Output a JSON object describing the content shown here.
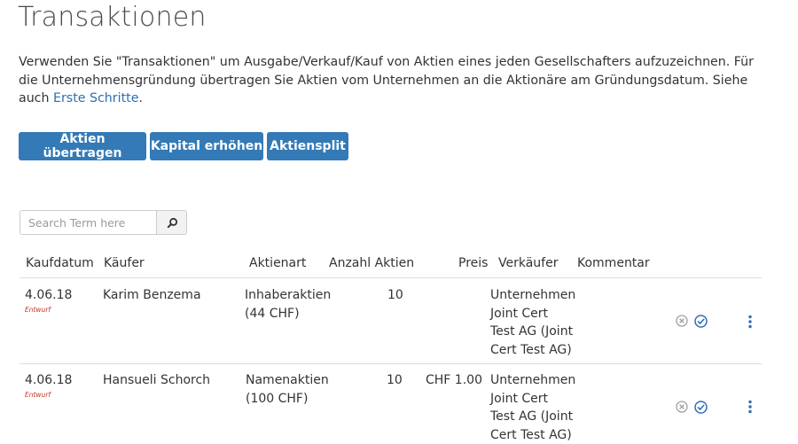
{
  "page": {
    "title": "Transaktionen",
    "intro_text": "Verwenden Sie \"Transaktionen\" um Ausgabe/Verkauf/Kauf von Aktien eines jeden Gesellschafters aufzuzeichnen. Für die Unternehmensgründung übertragen Sie Aktien vom Unternehmen an die Aktionäre am Gründungsdatum. Siehe auch ",
    "intro_link": "Erste Schritte",
    "intro_end": "."
  },
  "actions": {
    "transfer_label": "Aktien übertragen",
    "capital_label": "Kapital erhöhen",
    "split_label": "Aktiensplit"
  },
  "search": {
    "placeholder": "Search Term here",
    "value": ""
  },
  "table": {
    "headers": {
      "date": "Kaufdatum",
      "buyer": "Käufer",
      "share_type": "Aktienart",
      "share_count": "Anzahl Aktien",
      "price": "Preis",
      "seller": "Verkäufer",
      "comment": "Kommentar"
    },
    "rows": [
      {
        "date": "4.06.18",
        "status": "Entwurf",
        "buyer": "Karim Benzema",
        "share_type_1": "Inhaberaktien",
        "share_type_2": "(44 CHF)",
        "share_count": "10",
        "price": "",
        "seller_1": "Unternehmen",
        "seller_2": "Joint Cert",
        "seller_3": "Test AG (Joint",
        "seller_4": "Cert Test AG)",
        "comment": ""
      },
      {
        "date": "4.06.18",
        "status": "Entwurf",
        "buyer": "Hansueli Schorch",
        "share_type_1": "Namenaktien",
        "share_type_2": "(100 CHF)",
        "share_count": "10",
        "price": "CHF 1.00",
        "seller_1": "Unternehmen",
        "seller_2": "Joint Cert",
        "seller_3": "Test AG (Joint",
        "seller_4": "Cert Test AG)",
        "comment": ""
      }
    ]
  },
  "icons": {
    "search": "search-icon",
    "delete": "close-circle-icon",
    "confirm": "check-circle-icon",
    "menu": "more-vertical-icon"
  },
  "colors": {
    "primary_button": "#337ab7",
    "link": "#2a6fb3",
    "draft_status": "#c0392b",
    "icon_grey": "#a0a0a0",
    "icon_blue": "#2f6db5"
  }
}
